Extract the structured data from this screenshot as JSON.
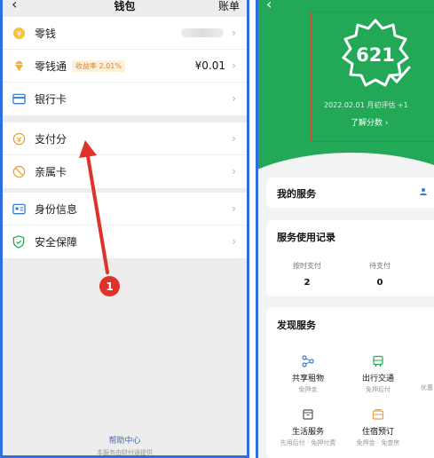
{
  "wallet": {
    "back": "‹",
    "title": "钱包",
    "bill": "账单",
    "items_group1": [
      {
        "icon": "coin-icon",
        "label": "零钱",
        "value": ""
      },
      {
        "icon": "diamond-icon",
        "label": "零钱通",
        "badge": "收益率 2.01%",
        "value": "¥0.01"
      },
      {
        "icon": "bank-card-icon",
        "label": "银行卡",
        "value": ""
      }
    ],
    "items_group2": [
      {
        "icon": "payscore-icon",
        "label": "支付分"
      },
      {
        "icon": "family-card-icon",
        "label": "亲属卡"
      }
    ],
    "items_group3": [
      {
        "icon": "id-card-icon",
        "label": "身份信息"
      },
      {
        "icon": "shield-icon",
        "label": "安全保障"
      }
    ],
    "chevron": "›",
    "help_center": "帮助中心",
    "footer_note": "本服务由财付通提供",
    "annotation_number": "1"
  },
  "score_page": {
    "back": "‹",
    "score": "621",
    "eval_date": "2022.02.01 月初评估 +1",
    "learn_more": "了解分数 ›",
    "my_services": "我的服务",
    "usage_record": "服务使用记录",
    "stats": [
      {
        "label": "按时支付",
        "value": "2"
      },
      {
        "label": "待支付",
        "value": "0"
      }
    ],
    "discover": "发现服务",
    "discover_items": [
      {
        "icon": "share-icon",
        "name": "共享租物",
        "sub": "免押金"
      },
      {
        "icon": "bus-icon",
        "name": "出行交通",
        "sub": "免押后付"
      },
      {
        "icon": "box-icon",
        "name": "生活服务",
        "sub": "先用后付 · 免押付费"
      },
      {
        "icon": "hotel-icon",
        "name": "住宿预订",
        "sub": "免押金 · 免查房"
      }
    ],
    "partial_right": "优惠"
  },
  "colors": {
    "accent_green": "#22a857",
    "frame_blue": "#2f6ee0",
    "annotation_red": "#e0312b"
  }
}
